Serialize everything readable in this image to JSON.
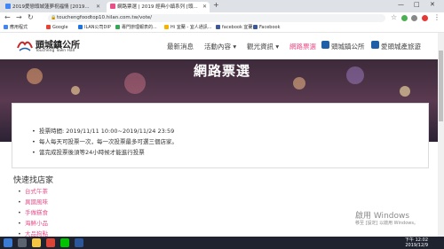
{
  "browser": {
    "tabs": [
      {
        "label": "2019愛戀頭城蓮夢祝福情 [2019..."
      },
      {
        "label": "網路票選 | 2019 經典小鎮系列 [頭..."
      }
    ],
    "url": "touchengfoodtop10.hilan.com.tw/vote/",
    "bookmarks": [
      "應用程式",
      "Google",
      "ILAN公司DIP",
      "專門辦理報表的...",
      "Hi 宜蘭 - 宜人通訊...",
      "facebook 宜蘭",
      "Facebook"
    ]
  },
  "site": {
    "logo": {
      "title": "頭城鎮公所",
      "subtitle": "Toucheng Town Hall"
    },
    "menu": [
      "最新消息",
      "活動內容 ▾",
      "觀光資訊 ▾",
      "網路票選",
      "頭城鎮公所",
      "愛頭城產旅遊"
    ],
    "hero_title": "網路票選",
    "info": {
      "items": [
        "投票時間: 2019/11/11 10:00~2019/11/24 23:59",
        "每人每天可投票一次，每一次投票最多可選三個店家。",
        "當完成投票後須等24小時候才能進行投票"
      ]
    },
    "stores_title": "快速找店家",
    "stores": [
      "台式午茶",
      "異國風味",
      "手做糕食",
      "海鮮小品",
      "大品狗點"
    ]
  },
  "os": {
    "watermark": "啟用 Windows",
    "watermark_sub": "移至 [設定] 以啟用 Windows。",
    "time": "下午 12:02",
    "date": "2019/12/9"
  }
}
